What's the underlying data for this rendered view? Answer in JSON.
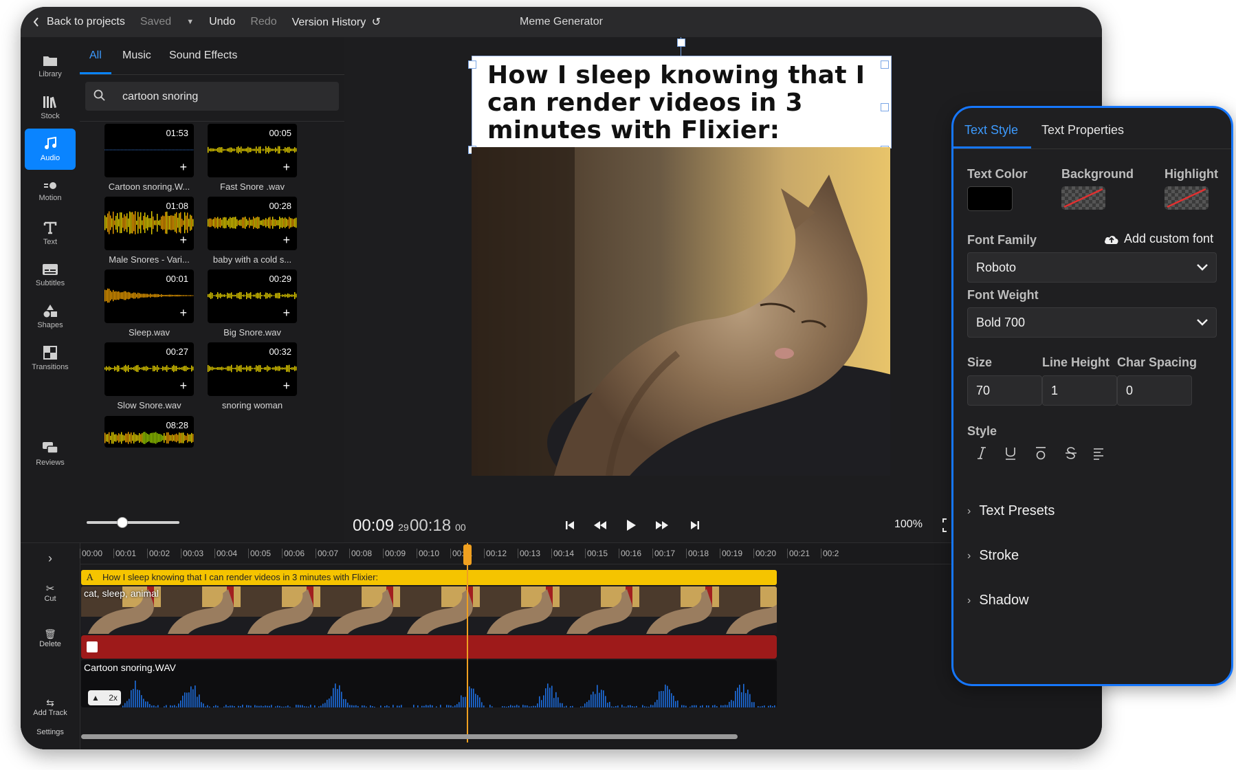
{
  "topbar": {
    "back": "Back to projects",
    "saved": "Saved",
    "undo": "Undo",
    "redo": "Redo",
    "version_history": "Version History",
    "title": "Meme Generator"
  },
  "nav": {
    "library": "Library",
    "stock": "Stock",
    "audio": "Audio",
    "motion": "Motion",
    "text": "Text",
    "subtitles": "Subtitles",
    "shapes": "Shapes",
    "transitions": "Transitions",
    "reviews": "Reviews"
  },
  "media": {
    "tabs": [
      "All",
      "Music",
      "Sound Effects"
    ],
    "search_value": "cartoon snoring",
    "items": [
      {
        "name": "Cartoon snoring.W...",
        "duration": "01:53",
        "wave": "thin"
      },
      {
        "name": "Fast Snore .wav",
        "duration": "00:05",
        "wave": "mid"
      },
      {
        "name": "Male Snores - Vari...",
        "duration": "01:08",
        "wave": "dense"
      },
      {
        "name": "baby with a cold s...",
        "duration": "00:28",
        "wave": "band"
      },
      {
        "name": "Sleep.wav",
        "duration": "00:01",
        "wave": "decay"
      },
      {
        "name": "Big Snore.wav",
        "duration": "00:29",
        "wave": "mid"
      },
      {
        "name": "Slow Snore.wav",
        "duration": "00:27",
        "wave": "mid"
      },
      {
        "name": "snoring woman",
        "duration": "00:32",
        "wave": "mid"
      },
      {
        "name": "",
        "duration": "08:28",
        "wave": "band"
      }
    ]
  },
  "preview": {
    "caption": "How I sleep knowing that I can render videos in 3 minutes with Flixier:",
    "current_time": "00:09",
    "current_frames": "29",
    "total_time": "00:18",
    "total_frames": "00",
    "zoom": "100%"
  },
  "timeline": {
    "tools": {
      "cut": "Cut",
      "delete": "Delete",
      "add_track": "Add Track",
      "settings": "Settings"
    },
    "ticks": [
      "00:00",
      "00:01",
      "00:02",
      "00:03",
      "00:04",
      "00:05",
      "00:06",
      "00:07",
      "00:08",
      "00:09",
      "00:10",
      "00:11",
      "00:12",
      "00:13",
      "00:14",
      "00:15",
      "00:16",
      "00:17",
      "00:18",
      "00:19",
      "00:20",
      "00:21",
      "00:2"
    ],
    "text_track": "How I sleep knowing that I can render videos in 3 minutes with Flixier:",
    "video_track_label": "cat, sleep, animal",
    "audio_track_label": "Cartoon snoring.WAV",
    "speed_badge": "2x"
  },
  "style_panel": {
    "tabs": [
      "Text Style",
      "Text Properties"
    ],
    "text_color_label": "Text Color",
    "background_label": "Background",
    "highlight_label": "Highlight",
    "font_family_label": "Font Family",
    "add_custom_font": "Add custom font",
    "font_family_value": "Roboto",
    "font_weight_label": "Font Weight",
    "font_weight_value": "Bold 700",
    "size_label": "Size",
    "size_value": "70",
    "line_height_label": "Line Height",
    "line_height_value": "1",
    "char_spacing_label": "Char Spacing",
    "char_spacing_value": "0",
    "style_label": "Style",
    "sections": [
      "Text Presets",
      "Stroke",
      "Shadow"
    ],
    "colors": {
      "text_color": "#000000",
      "accent": "#1677ff"
    }
  }
}
